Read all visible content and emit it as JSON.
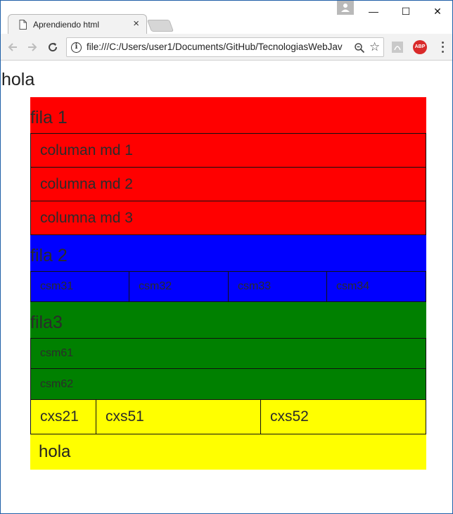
{
  "browser": {
    "tab_title": "Aprendiendo html",
    "tab_close": "×",
    "url": "file:///C:/Users/user1/Documents/GitHub/TecnologiasWebJav",
    "window_controls": {
      "minimize": "—",
      "maximize": "☐",
      "close": "✕"
    },
    "extensions": {
      "abp": "ABP"
    }
  },
  "page": {
    "heading": "hola",
    "rows": {
      "row1": {
        "label": "fila 1",
        "color": "#ff0000",
        "columns": [
          "columan md 1",
          "columna md 2",
          "columna md 3"
        ]
      },
      "row2": {
        "label": "fila 2",
        "color": "#0000ff",
        "columns": [
          "csm31",
          "csm32",
          "csm33",
          "csm34"
        ]
      },
      "row3": {
        "label": "fila3",
        "color": "#008000",
        "columns": [
          "csm61",
          "csm62"
        ]
      },
      "row4": {
        "color": "#ffff00",
        "columns": [
          "cxs21",
          "cxs51",
          "cxs52"
        ],
        "footer": "hola"
      }
    }
  }
}
